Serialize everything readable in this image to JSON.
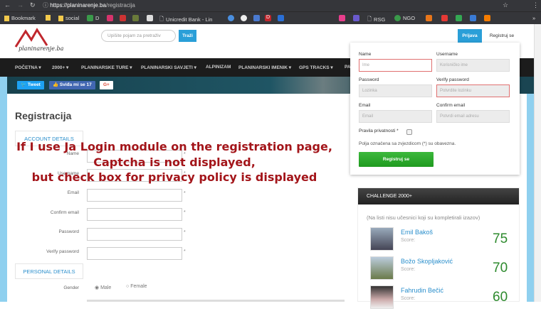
{
  "browser": {
    "url_domain": "https://planinarenje.ba",
    "url_path": "/registracija",
    "bookmarks": [
      "Bookmark",
      "social",
      "D",
      "Unicredit Bank - Lin",
      "D",
      "RSG",
      "NGO"
    ]
  },
  "header": {
    "logo_text": "planinarenje.ba",
    "search_placeholder": "Upišite pojam za pretraživ",
    "search_button": "Traži",
    "login_tab": "Prijava",
    "register_tab": "Registruj se"
  },
  "nav": [
    "POČETNA ▾",
    "2000+ ▾",
    "PLANINARSKE TURE ▾",
    "PLANINARSKI SAVJETI ▾",
    "ALPINIZAM",
    "PLANINARSKI IMENIK ▾",
    "GPS TRACKS ▾",
    "PA"
  ],
  "social": {
    "tweet": "Tweet",
    "like": "Sviđa mi se 17",
    "gplus": "G+"
  },
  "form": {
    "title": "Registracija",
    "account_section": "ACCOUNT DETAILS",
    "fields": [
      "Name",
      "Username",
      "Email",
      "Confirm email",
      "Password",
      "Verify password"
    ],
    "required": "*",
    "personal_section": "PERSONAL DETAILS",
    "gender_label": "Gender",
    "male": "Male",
    "female": "Female"
  },
  "overlay": [
    "If I use  Ja Login module on the registration page,",
    "Captcha is not displayed,",
    "but check box for privacy policy is displayed"
  ],
  "panel": {
    "name_label": "Name",
    "name_ph": "Ime",
    "username_label": "Username",
    "username_ph": "Korisničko ime",
    "password_label": "Password",
    "password_ph": "Lozinka",
    "verify_label": "Verify password",
    "verify_ph": "Potvrdite lozinku",
    "email_label": "Email",
    "email_ph": "Email",
    "confirm_label": "Confirm email",
    "confirm_ph": "Potvrdi email adresu",
    "privacy_label": "Pravila privatnosti *",
    "note": "Polja označena sa zvjezdicom (*) su obavezna.",
    "submit": "Registruj se"
  },
  "challenge": {
    "title": "CHALLENGE 2000+",
    "subtitle": "(Na listi nisu učesnici koji su kompletirali izazov)",
    "score_label": "Score:",
    "people": [
      {
        "name": "Emil Bakoš",
        "score": "75"
      },
      {
        "name": "Božo Skopljaković",
        "score": "70"
      },
      {
        "name": "Fahrudin Bečić",
        "score": "60"
      }
    ]
  }
}
